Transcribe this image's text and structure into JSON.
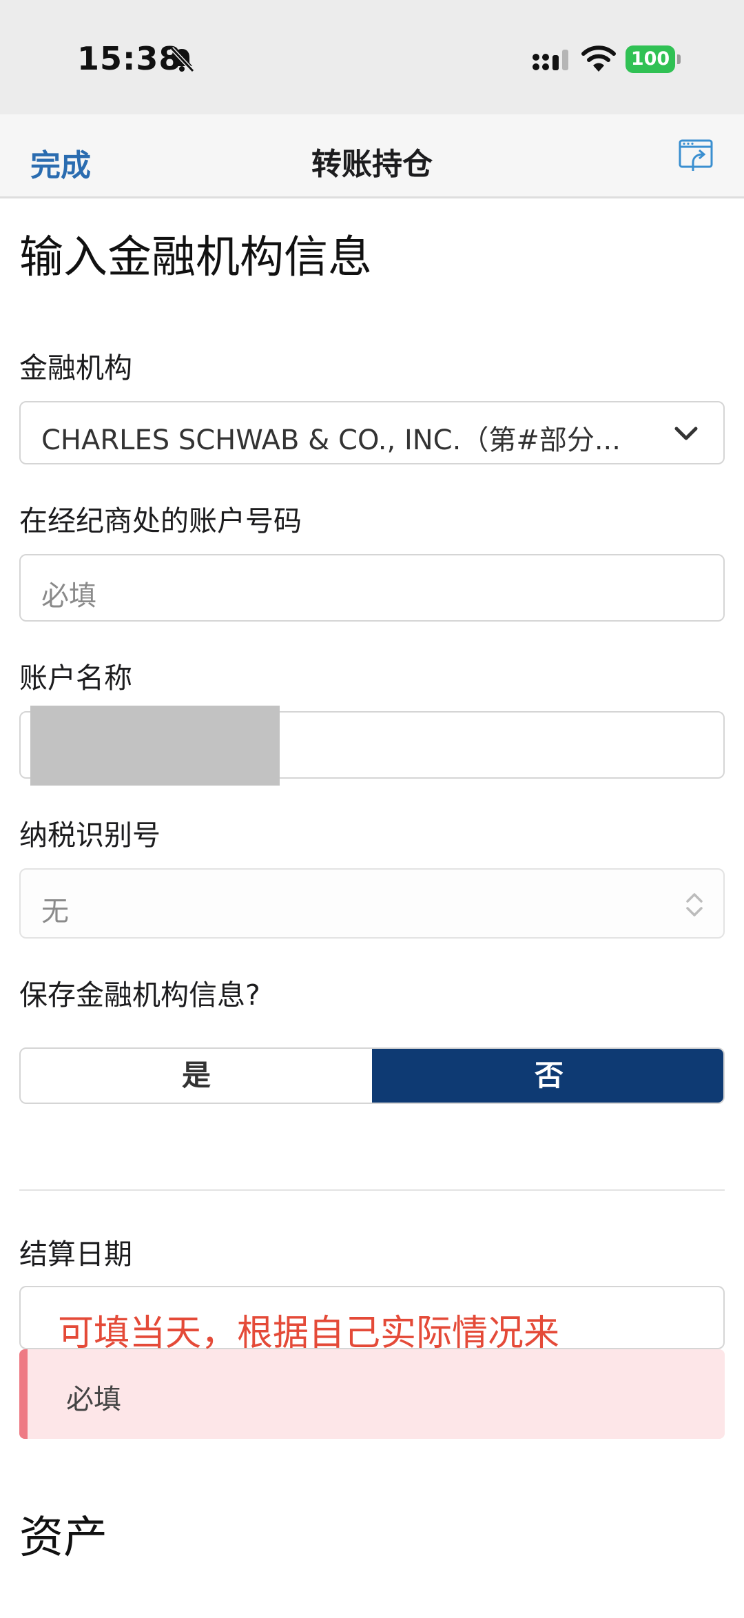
{
  "status_bar": {
    "time": "15:38",
    "battery": "100"
  },
  "nav": {
    "done": "完成",
    "title": "转账持仓"
  },
  "form": {
    "heading": "输入金融机构信息",
    "institution": {
      "label": "金融机构",
      "value": "CHARLES SCHWAB & CO., INC.（第#部分..."
    },
    "account_number": {
      "label": "在经纪商处的账户号码",
      "placeholder": "必填"
    },
    "account_name": {
      "label": "账户名称"
    },
    "tax_id": {
      "label": "纳税识别号",
      "value": "无"
    },
    "save_info": {
      "label": "保存金融机构信息?",
      "yes": "是",
      "no": "否",
      "selected": "否"
    },
    "settlement_date": {
      "label": "结算日期",
      "annotation": "可填当天，根据自己实际情况来",
      "error": "必填"
    },
    "assets_heading": "资产"
  },
  "colors": {
    "accent_link": "#2a6cb0",
    "selected_toggle": "#0e3a73",
    "battery": "#30c154",
    "error_bg": "#fde6e8",
    "error_bar": "#ee7a84",
    "annotation": "#e44a38"
  }
}
